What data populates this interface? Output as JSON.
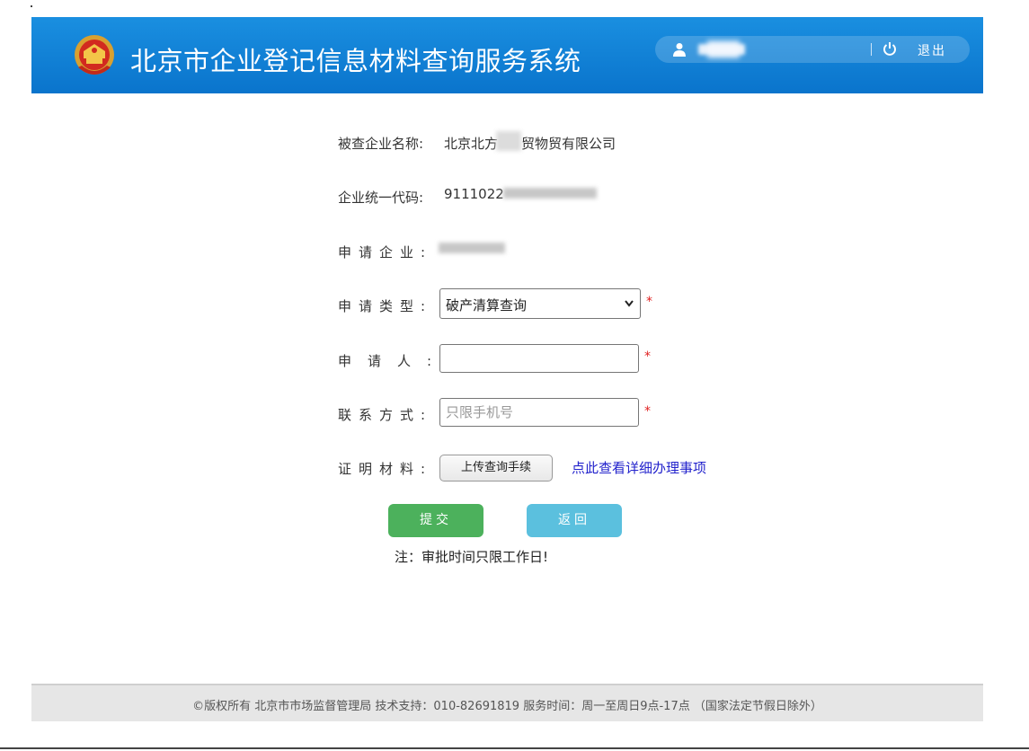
{
  "header": {
    "title": "北京市企业登记信息材料查询服务系统",
    "logout_label": "退出",
    "brand_color": "#0a74cc"
  },
  "form": {
    "company_name_label": "被查企业名称:",
    "company_name_value_a": "北京北方",
    "company_name_value_b": "贸物贸有限公司",
    "credit_code_label": "企业统一代码:",
    "credit_code_value": "9111022",
    "applicant_company_label": "申请企业:",
    "apply_type_label": "申请类型:",
    "apply_type_value": "破产清算查询",
    "applicant_label": "申请人:",
    "applicant_value": "",
    "contact_label": "联系方式:",
    "contact_placeholder": "只限手机号",
    "proof_label": "证明材料:",
    "upload_button": "上传查询手续",
    "details_link": "点此查看详细办理事项",
    "required_mark": "*"
  },
  "actions": {
    "submit_label": "提交",
    "back_label": "返回",
    "submit_color": "#4cb15c",
    "back_color": "#5bc0de"
  },
  "note": "注：审批时间只限工作日!",
  "footer": {
    "text": "©版权所有 北京市市场监督管理局   技术支持：010-82691819    服务时间：周一至周日9点-17点  （国家法定节假日除外）"
  }
}
